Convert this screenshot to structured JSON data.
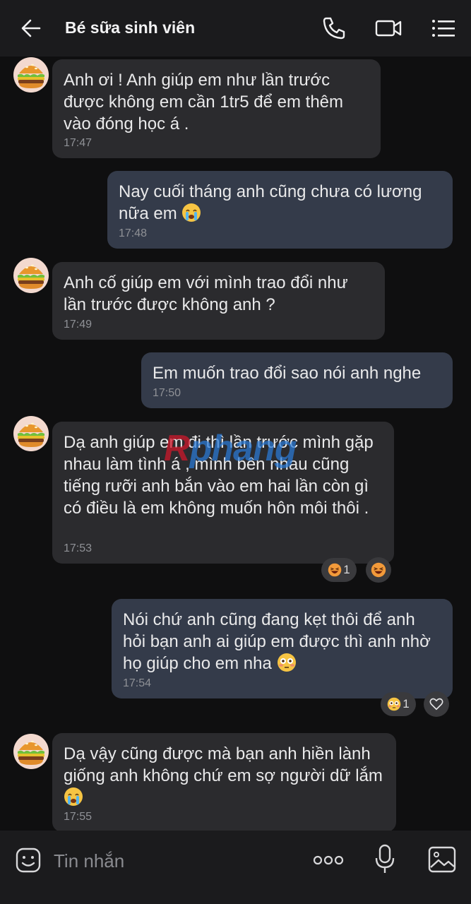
{
  "header": {
    "title": "Bé sữa sinh viên",
    "icons": [
      "back-arrow-icon",
      "phone-icon",
      "video-call-icon",
      "list-menu-icon"
    ]
  },
  "messages": [
    {
      "direction": "in",
      "text": "Anh ơi ! Anh giúp em như lần trước được không em cần 1tr5 để em thêm vào đóng học á .",
      "time": "17:47"
    },
    {
      "direction": "out",
      "text": "Nay cuối tháng anh cũng chưa có lương nữa em",
      "emoji": "crying-face",
      "time": "17:48"
    },
    {
      "direction": "in",
      "text": "Anh cố giúp em với mình trao đổi như lần trước được không anh ?",
      "time": "17:49"
    },
    {
      "direction": "out",
      "text": "Em muốn trao đổi sao nói anh nghe",
      "time": "17:50"
    },
    {
      "direction": "in",
      "text": "Dạ anh giúp em đi thì lần trước mình gặp nhau làm tình á , mình bên nhau cũng tiếng rưỡi anh bắn vào em hai lần còn gì có điều là em không muốn hôn môi thôi .",
      "time": "17:53",
      "reactions": [
        {
          "emoji": "laughing-face",
          "count": "1"
        },
        {
          "emoji": "laughing-face",
          "count": ""
        }
      ]
    },
    {
      "direction": "out",
      "text": "Nói chứ anh cũng đang kẹt thôi để anh hỏi bạn anh ai giúp em được thì anh nhờ họ giúp cho em nha",
      "emoji": "flushed-face",
      "time": "17:54",
      "reactions": [
        {
          "emoji": "flushed-face",
          "count": "1"
        },
        {
          "emoji": "heart-outline-icon",
          "count": ""
        }
      ]
    },
    {
      "direction": "in",
      "text": "Dạ vậy cũng được mà bạn anh hiền lành giống anh không chứ em sợ người dữ lắm",
      "emoji": "crying-face",
      "time": "17:55"
    }
  ],
  "watermark": {
    "left": "R",
    "right": "phang"
  },
  "composer": {
    "placeholder": "Tin nhắn",
    "icons": [
      "sticker-icon",
      "more-dots-icon",
      "microphone-icon",
      "image-icon"
    ]
  },
  "colors": {
    "background": "#0f0f10",
    "header": "#1b1b1d",
    "incoming_bubble": "#2b2b2e",
    "outgoing_bubble": "#343b4a",
    "timestamp": "#8f9196"
  }
}
